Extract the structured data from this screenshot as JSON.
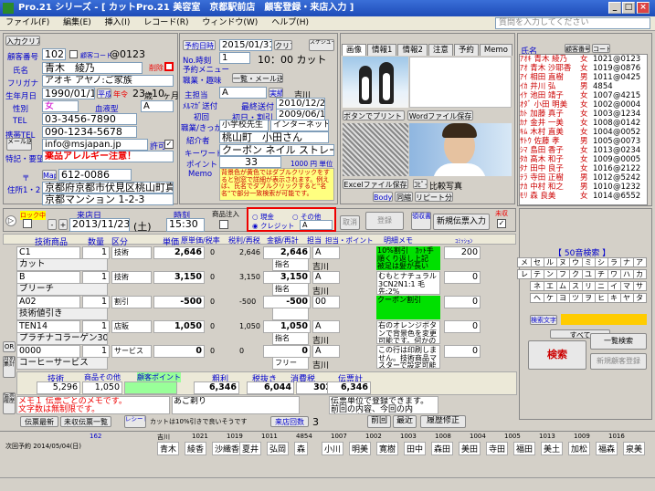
{
  "window": {
    "title": "Pro.21 シリーズ - [ カットPro.21 美容室　京都駅前店　顧客登録・来店入力 ]"
  },
  "menu": [
    "ファイル(F)",
    "編集(E)",
    "挿入(I)",
    "レコード(R)",
    "ウィンドウ(W)",
    "ヘルプ(H)"
  ],
  "search": {
    "placeholder": "質問を入力してください"
  },
  "customer": {
    "input_btn": "入力クリア",
    "no_label": "顧客番号",
    "no": "1021",
    "code_label": "顧客コード",
    "code": "@0123",
    "name_label": "氏名",
    "name": "青木　綾乃",
    "flag": "削除",
    "kana_label": "フリガナ",
    "kana": "アオキ アヤノ:ご家族",
    "birth_label": "生年月日",
    "birth": "1990/01/15",
    "era": "平成",
    "age_label": "年令",
    "age": "23",
    "age_unit": "歳",
    "month": "10",
    "month_unit": "ヶ月",
    "sex_label": "性別",
    "sex": "女",
    "blood_label": "血液型",
    "blood": "A",
    "tel_label": "TEL",
    "tel": "03-3456-7890",
    "mobile_label": "携帯TEL",
    "mobile": "090-1234-5678",
    "mail_btn": "メール送信",
    "mail": "info@msjapan.jp",
    "permit": "許可",
    "note_label": "特記・要望",
    "note": "薬品アレルギー注意！",
    "zip_label": "〒",
    "map_btn": "Map",
    "zip": "612-0086",
    "addr_label": "住所1・2",
    "addr1": "京都府京都市伏見区桃山町真齊",
    "addr2": "京都マンション 1-2-3"
  },
  "visitinfo": {
    "next_label": "予約日時",
    "next": "2015/01/31",
    "clear": "クリア",
    "schedule": "スケジュール確認",
    "time_label": "No.時刻",
    "time": "1",
    "menu_label": "予約メニュー",
    "menu_val": "10：00  カット",
    "memo_label": "職業・趣味",
    "memo_btn": "一覧・メール送信",
    "staff_label": "主担当",
    "staff": "A",
    "staff_btn": "実績",
    "staff_name": "吉川",
    "mail_label": "ﾒﾙﾏｶﾞ送付",
    "mail_date_label": "最終送付",
    "mail_date": "2010/12/20",
    "first_label": "初回",
    "first_label2": "初日・割引",
    "first_date": "2009/06/10",
    "job_label": "職業/きっかけ",
    "job": "小学校先生",
    "job2": "インターネット",
    "intro_label": "紹介者",
    "intro": "桃山町　小田さん",
    "kw_label": "キーワード",
    "kw": "クーポン ネイル ストレート",
    "point_label": "ポイント",
    "point": "33",
    "point_unit": "1000 円 単位",
    "memo2_label": "Memo",
    "memo2": "背景色が黄色ではダブルクリックをすると別窓で詳細が表示されます。例えば、氏名でダブルクリックすると\"名名\"で部分一致検索が可能です。"
  },
  "image_panel": {
    "tabs": [
      "画像",
      "情報1",
      "情報2",
      "注意",
      "予約",
      "Memo"
    ],
    "print_btn": "ボタンでプリント →",
    "word_btn": "Wordファイル保存",
    "excel_btn": "Excelファイル保存",
    "photo_btn": "ｺﾋﾟｰ",
    "photo_label": "比較写真",
    "body_btn": "Body",
    "scale_btn": "同縮",
    "repeat_btn": "リピート分析"
  },
  "custlist": {
    "header_name": "氏名",
    "header_staff": "顧客番号",
    "header_code": "コード",
    "rows": [
      [
        "ｱｵｷ 青木",
        "綾乃",
        "女",
        "1021",
        "@0123"
      ],
      [
        "ｱｵ 青木",
        "沙耶香",
        "女",
        "1019",
        "@0876"
      ],
      [
        "ｱｲ 相田",
        "直樹",
        "男",
        "1011",
        "@0425"
      ],
      [
        "ｲｶ 井川",
        "弘",
        "男",
        "4854",
        ""
      ],
      [
        "ｲｹ 池田",
        "靖子",
        "女",
        "1007",
        "@4215"
      ],
      [
        "ｵﾀﾞ 小田",
        "明美",
        "女",
        "1002",
        "@0004"
      ],
      [
        "ｶﾄ 加藤",
        "真子",
        "女",
        "1003",
        "@1234"
      ],
      [
        "ｶﾅ 金井",
        "一美",
        "女",
        "1008",
        "@0142"
      ],
      [
        "ｷﾑ 木村",
        "直美",
        "女",
        "1004",
        "@0052"
      ],
      [
        "ｻﾄｳ 佐藤",
        "孝",
        "男",
        "1005",
        "@0073"
      ],
      [
        "ｼﾏ 島田",
        "香子",
        "女",
        "1013",
        "@0234"
      ],
      [
        "ﾀｶ 高木",
        "和子",
        "女",
        "1009",
        "@0005"
      ],
      [
        "ﾀﾅ 田中",
        "良子",
        "女",
        "1016",
        "@2122"
      ],
      [
        "ﾃﾗ 寺田",
        "正樹",
        "男",
        "1012",
        "@5242"
      ],
      [
        "ﾅｶ 中村",
        "和之",
        "男",
        "1010",
        "@1232"
      ],
      [
        "ﾓﾘ 森",
        "良美",
        "女",
        "1014",
        "@6552"
      ]
    ],
    "kana_title": "【 50音検索 】",
    "search_btn": "検索",
    "all_btn": "すべて",
    "inc_btn": "一覧検索",
    "new_btn": "新規顧客登録"
  },
  "visit": {
    "lock_label": "ロック中",
    "date_label": "来店日",
    "date": "2013/11/23",
    "dow": "(土)",
    "time_label": "時刻",
    "time": "15:30",
    "goods_label": "商品注入",
    "pay_cash": "現金",
    "pay_other": "その他",
    "pay_credit": "クレジット",
    "pay_other_val": "A",
    "cancel_btn": "取消",
    "reg_btn": "登録",
    "print_btn": "領収書印刷",
    "new_btn": "新規伝票入力",
    "status_label": "未収"
  },
  "columns": {
    "item": "技術商品",
    "qty": "数量",
    "kind": "区分",
    "price": "単価",
    "unit_price": "原単価/税率",
    "ratio": "税利/再税",
    "amount": "金額/再計",
    "staff": "担当",
    "pt": "担当・ポイント",
    "memo": "明細メモ",
    "comm": "ｺﾐｯｼｮﾝ"
  },
  "lines": [
    {
      "item": "C1",
      "sub": "カット",
      "qty": "1",
      "kind": "技術",
      "price": "2,646",
      "q2": "0",
      "uprice": "2,646",
      "amount": "2,646",
      "staff": "A",
      "sname": "指名",
      "pstaff": "吉川",
      "memo": "10%割引　ｶｯﾄ手順くり返し上記　被足は髪が長い",
      "comm": "200"
    },
    {
      "item": "B",
      "sub": "ブリーチ",
      "qty": "1",
      "kind": "技術",
      "price": "3,150",
      "q2": "0",
      "uprice": "3,150",
      "amount": "3,150",
      "staff": "A",
      "sname": "指名",
      "pstaff": "吉川",
      "memo": "むもとナチュラル 3CN2N1:1 毛先:2%",
      "comm": "0"
    },
    {
      "item": "A02",
      "sub": "技術値引き",
      "qty": "1",
      "kind": "割引",
      "price": "-500",
      "q2": "0",
      "uprice": "-500",
      "amount": "-500",
      "staff": "00",
      "sname": "",
      "pstaff": "",
      "memo": "クーポン割引",
      "comm": "0"
    },
    {
      "item": "TEN14",
      "sub": "プラチナコラーゲン30g",
      "qty": "1",
      "kind": "店販",
      "price": "1,050",
      "q2": "0",
      "uprice": "1,050",
      "amount": "1,050",
      "staff": "A",
      "sname": "指名",
      "pstaff": "吉川",
      "memo": "右のオレンジボタンで背景色を変更可能です。何かの目印などにお使い下さい。",
      "comm": "0"
    },
    {
      "item": "0000",
      "sub": "コーヒーサービス",
      "qty": "1",
      "kind": "サービス",
      "price": "0",
      "q2": "0",
      "uprice": "0",
      "amount": "0",
      "staff": "A",
      "sname": "フリー",
      "pstaff": "吉川",
      "memo": "この行は印刷しません。技術商品マスターで設定可能です。",
      "comm": "0"
    }
  ],
  "totals": {
    "tech_label": "技術",
    "tech": "5,296",
    "goods_label": "商品その他",
    "goods": "1,050",
    "pt_label": "顧客ポイント",
    "pt": "",
    "sub_label": "粗利",
    "sub": "6,346",
    "ex_label": "税抜き",
    "ex": "6,044",
    "tax_label": "消費税",
    "tax": "302",
    "total_label": "伝票計",
    "total": "6,346",
    "memo1": "メモ１ 伝票ごとのメモです。",
    "memo1b": "文字数は無制限です。",
    "memo2": "あご剃り",
    "memo3": "伝票単位で登録できます。",
    "memo3b": "前回の内容、今回の内容……など",
    "slip_btn": "伝票最新",
    "slip_list": "未収伝票一覧",
    "receipt_btn": "レシート発行",
    "info": "カットは10%引きで良いそうです",
    "visit_label": "来店回数",
    "visit_cnt": "3",
    "prev_btn": "前回",
    "recent_btn": "最近",
    "history_btn": "履歴修正"
  },
  "bottom": {
    "next_label": "次回予約 2014/05/04(日)",
    "cycle": "162",
    "staff_tabs": [
      "吉川",
      "1021",
      "1019",
      "1011",
      "4854",
      "1007",
      "1002",
      "1003",
      "1008",
      "1004",
      "1005",
      "1013",
      "1009",
      "1016"
    ],
    "names": [
      "青木",
      "綾香",
      "沙織香",
      "夏井",
      "弘岡",
      "森",
      "小川",
      "明美",
      "寛樹",
      "田中",
      "森田",
      "美田",
      "寺田",
      "福田",
      "美土",
      "加松",
      "福森",
      "泉美"
    ]
  },
  "colors": {
    "title": "#1e4cb8",
    "accent_green": "#00e000",
    "red": "#e00000",
    "yellow": "#ffff80"
  }
}
